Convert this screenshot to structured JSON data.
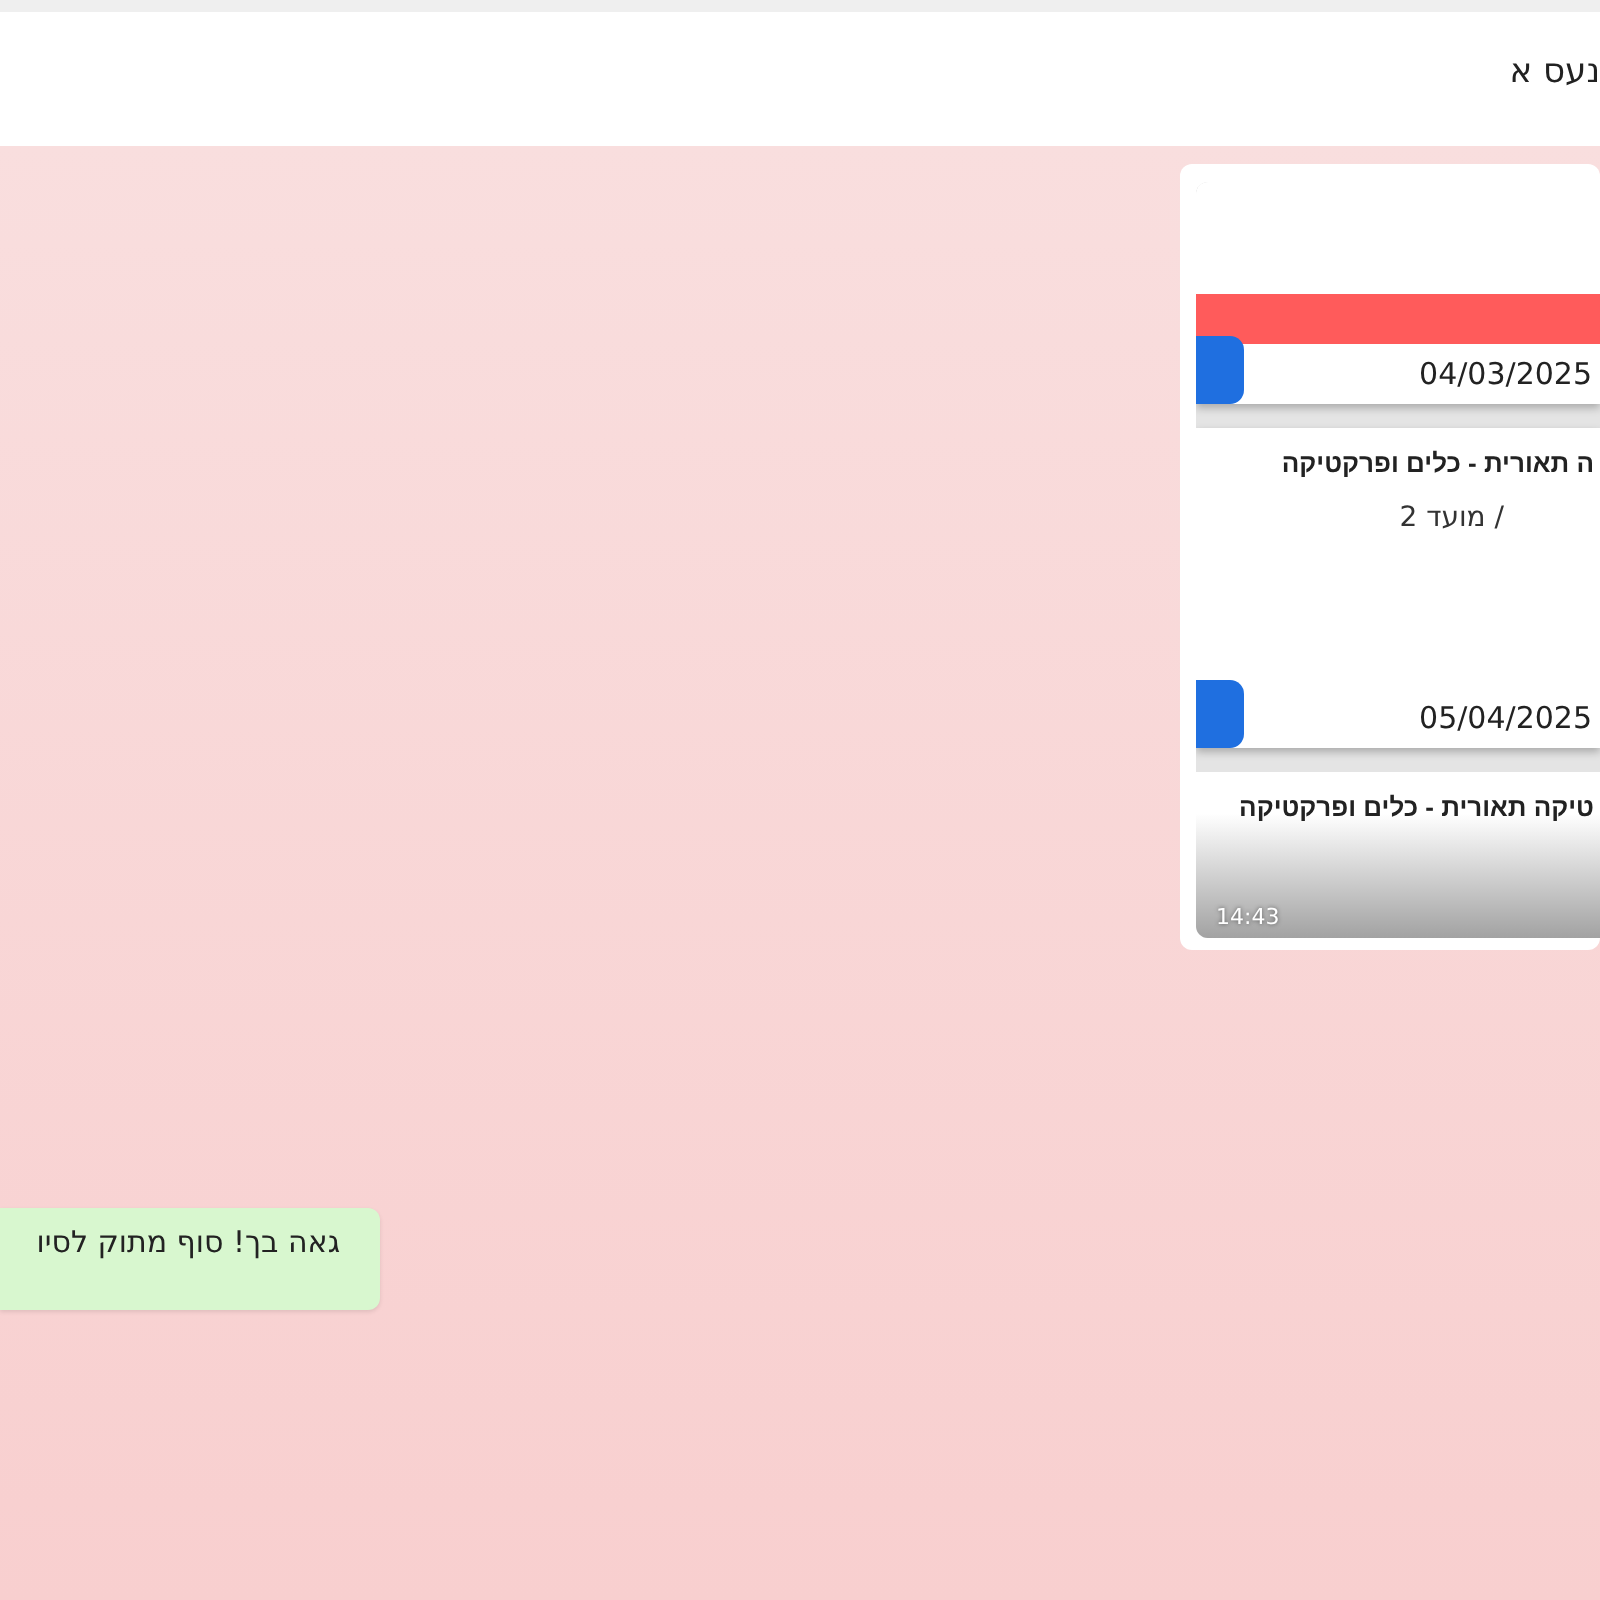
{
  "header": {
    "title": "נעס א"
  },
  "messages": [
    {
      "kind": "image",
      "time": "14:43",
      "cards": [
        {
          "flagged": true,
          "date": "04/03/2025"
        },
        {
          "title": "ה תאורית - כלים ופרקטיקה",
          "subtitle": "/ מועד 2",
          "flagged": false,
          "date": "05/04/2025"
        },
        {
          "title": "טיקה תאורית - כלים ופרקטיקה",
          "flagged": false
        }
      ]
    },
    {
      "kind": "text",
      "text": "גאה בך! סוף מתוק לסיו"
    }
  ]
}
